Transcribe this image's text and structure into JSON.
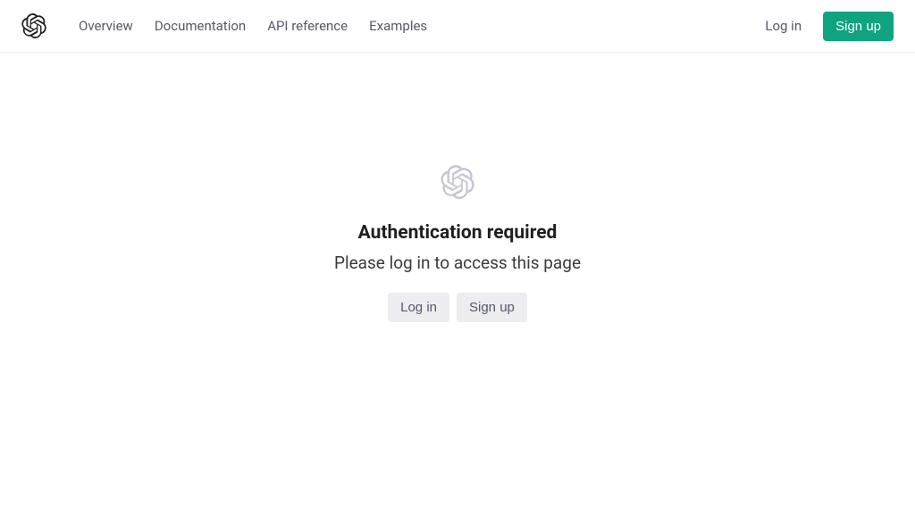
{
  "nav": {
    "items": [
      "Overview",
      "Documentation",
      "API reference",
      "Examples"
    ]
  },
  "header_auth": {
    "login": "Log in",
    "signup": "Sign up"
  },
  "main": {
    "title": "Authentication required",
    "subtitle": "Please log in to access this page",
    "login_button": "Log in",
    "signup_button": "Sign up"
  },
  "colors": {
    "accent": "#10a37f",
    "gray_icon": "#c5c5d2"
  }
}
